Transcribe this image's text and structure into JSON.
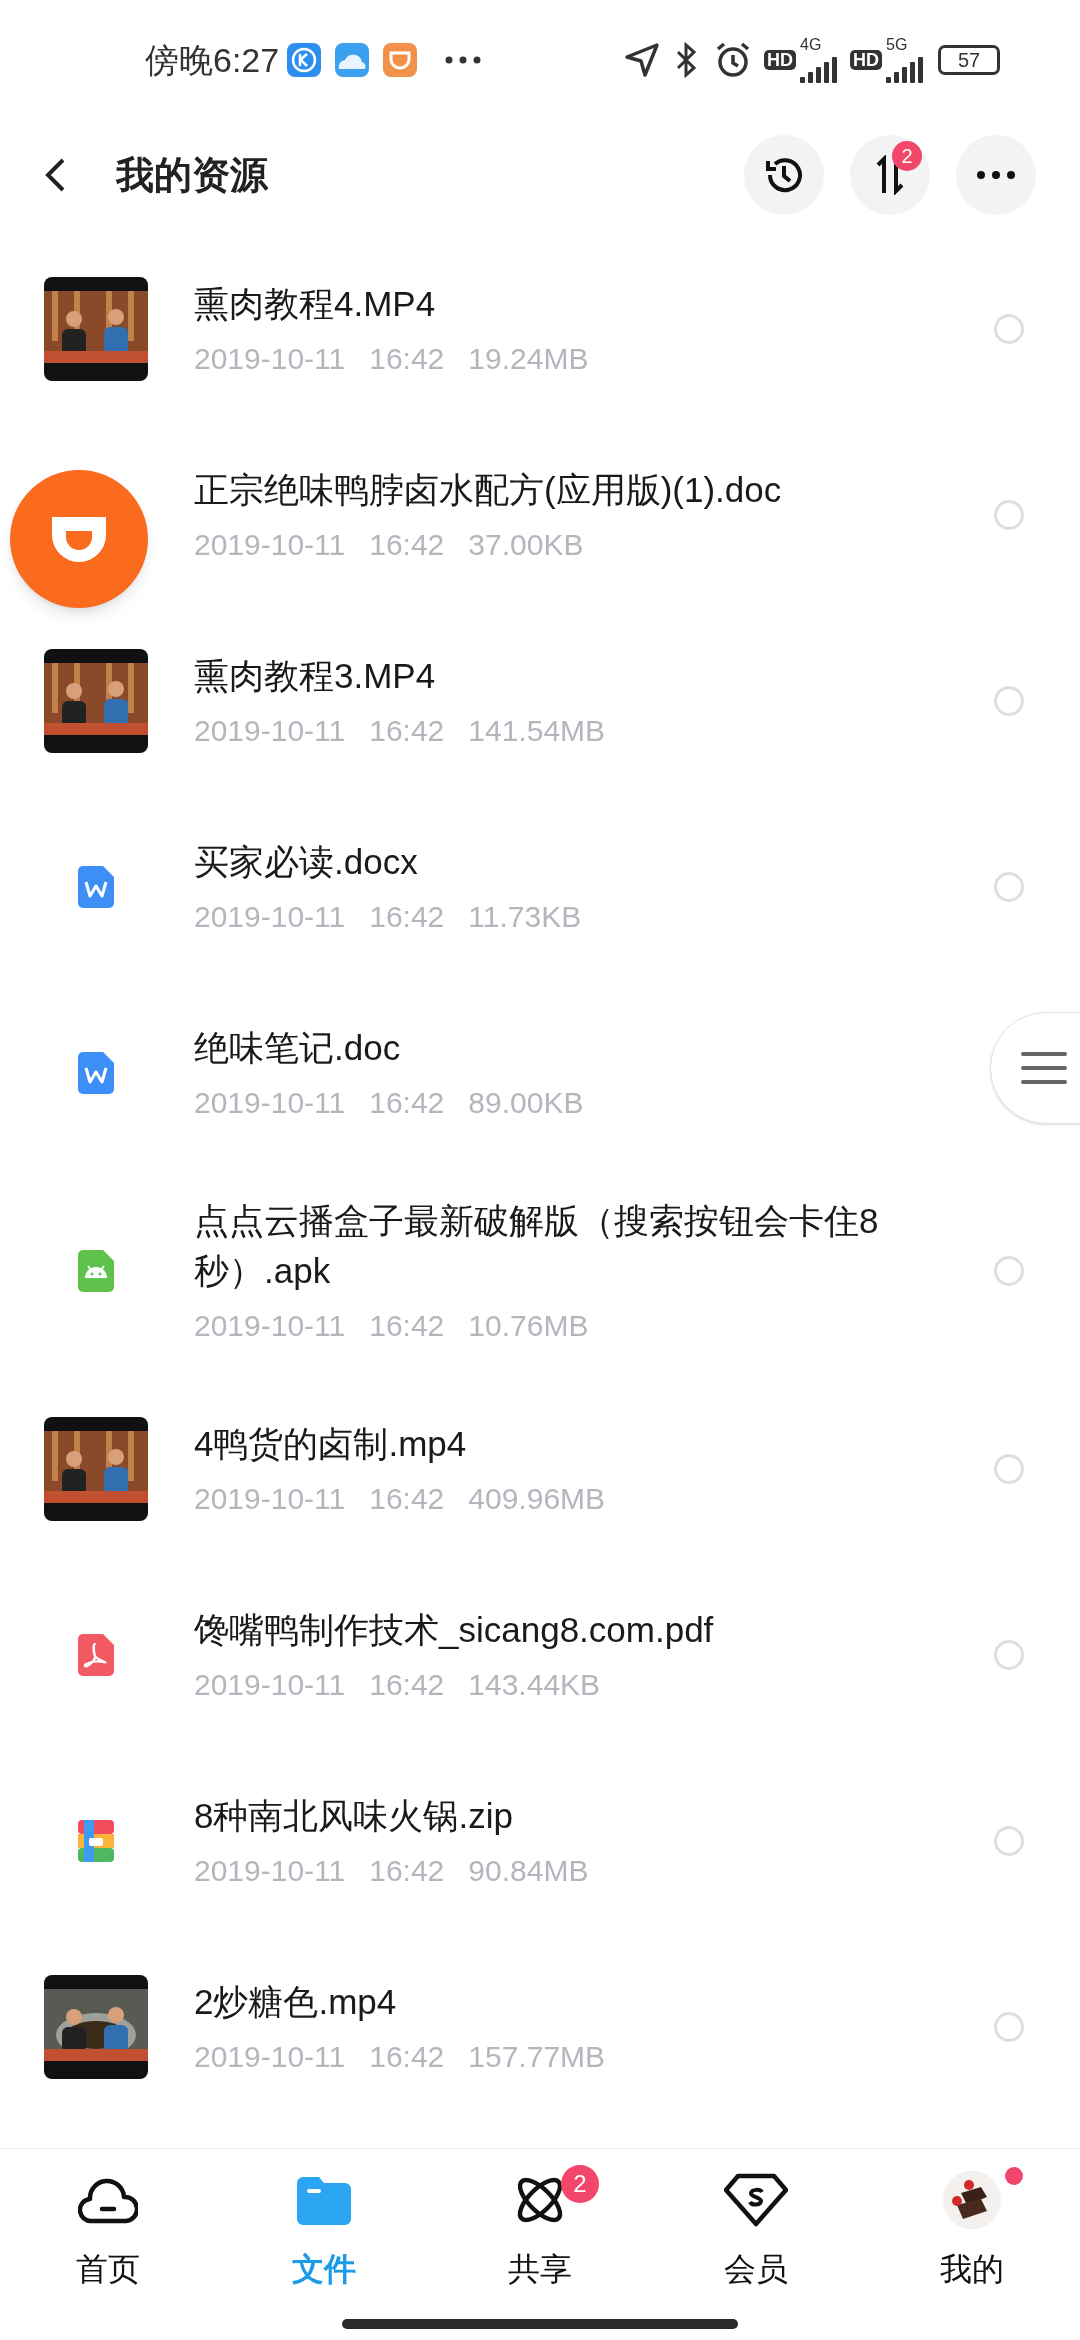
{
  "status_bar": {
    "time": "傍晚6:27",
    "sim1": {
      "hd": "HD",
      "network": "4G"
    },
    "sim2": {
      "hd": "HD",
      "network": "5G"
    },
    "battery": "57"
  },
  "header": {
    "title": "我的资源",
    "transfer_badge": "2"
  },
  "files": [
    {
      "name": "熏肉教程4.MP4",
      "date": "2019-10-11",
      "time": "16:42",
      "size": "19.24MB",
      "kind": "video",
      "selected": false
    },
    {
      "name": "正宗绝味鸭脖卤水配方(应用版)(1).doc",
      "date": "2019-10-11",
      "time": "16:42",
      "size": "37.00KB",
      "selected": false
    },
    {
      "name": "熏肉教程3.MP4",
      "date": "2019-10-11",
      "time": "16:42",
      "size": "141.54MB",
      "kind": "video",
      "selected": false
    },
    {
      "name": "买家必读.docx",
      "date": "2019-10-11",
      "time": "16:42",
      "size": "11.73KB",
      "kind": "word",
      "selected": false
    },
    {
      "name": "绝味笔记.doc",
      "date": "2019-10-11",
      "time": "16:42",
      "size": "89.00KB",
      "kind": "word"
    },
    {
      "name": "点点云播盒子最新破解版（搜索按钮会卡住8秒）.apk",
      "date": "2019-10-11",
      "time": "16:42",
      "size": "10.76MB",
      "kind": "apk",
      "selected": false
    },
    {
      "name": "4鸭货的卤制.mp4",
      "date": "2019-10-11",
      "time": "16:42",
      "size": "409.96MB",
      "kind": "video",
      "selected": false
    },
    {
      "name": "馋嘴鸭制作技术_sicang8.com.pdf",
      "date": "2019-10-11",
      "time": "16:42",
      "size": "143.44KB",
      "kind": "pdf",
      "selected": false
    },
    {
      "name": "8种南北风味火锅.zip",
      "date": "2019-10-11",
      "time": "16:42",
      "size": "90.84MB",
      "kind": "zip",
      "selected": false
    },
    {
      "name": "2炒糖色.mp4",
      "date": "2019-10-11",
      "time": "16:42",
      "size": "157.77MB",
      "kind": "video",
      "selected": false
    }
  ],
  "nav": [
    {
      "label": "首页",
      "selected": false,
      "kind": "home",
      "dot": false
    },
    {
      "label": "文件",
      "selected": true,
      "kind": "files",
      "dot": false
    },
    {
      "label": "共享",
      "selected": false,
      "kind": "share",
      "badge": "2",
      "dot": false
    },
    {
      "label": "会员",
      "selected": false,
      "kind": "vip",
      "dot": false
    },
    {
      "label": "我的",
      "selected": false,
      "kind": "me",
      "dot": true
    }
  ]
}
